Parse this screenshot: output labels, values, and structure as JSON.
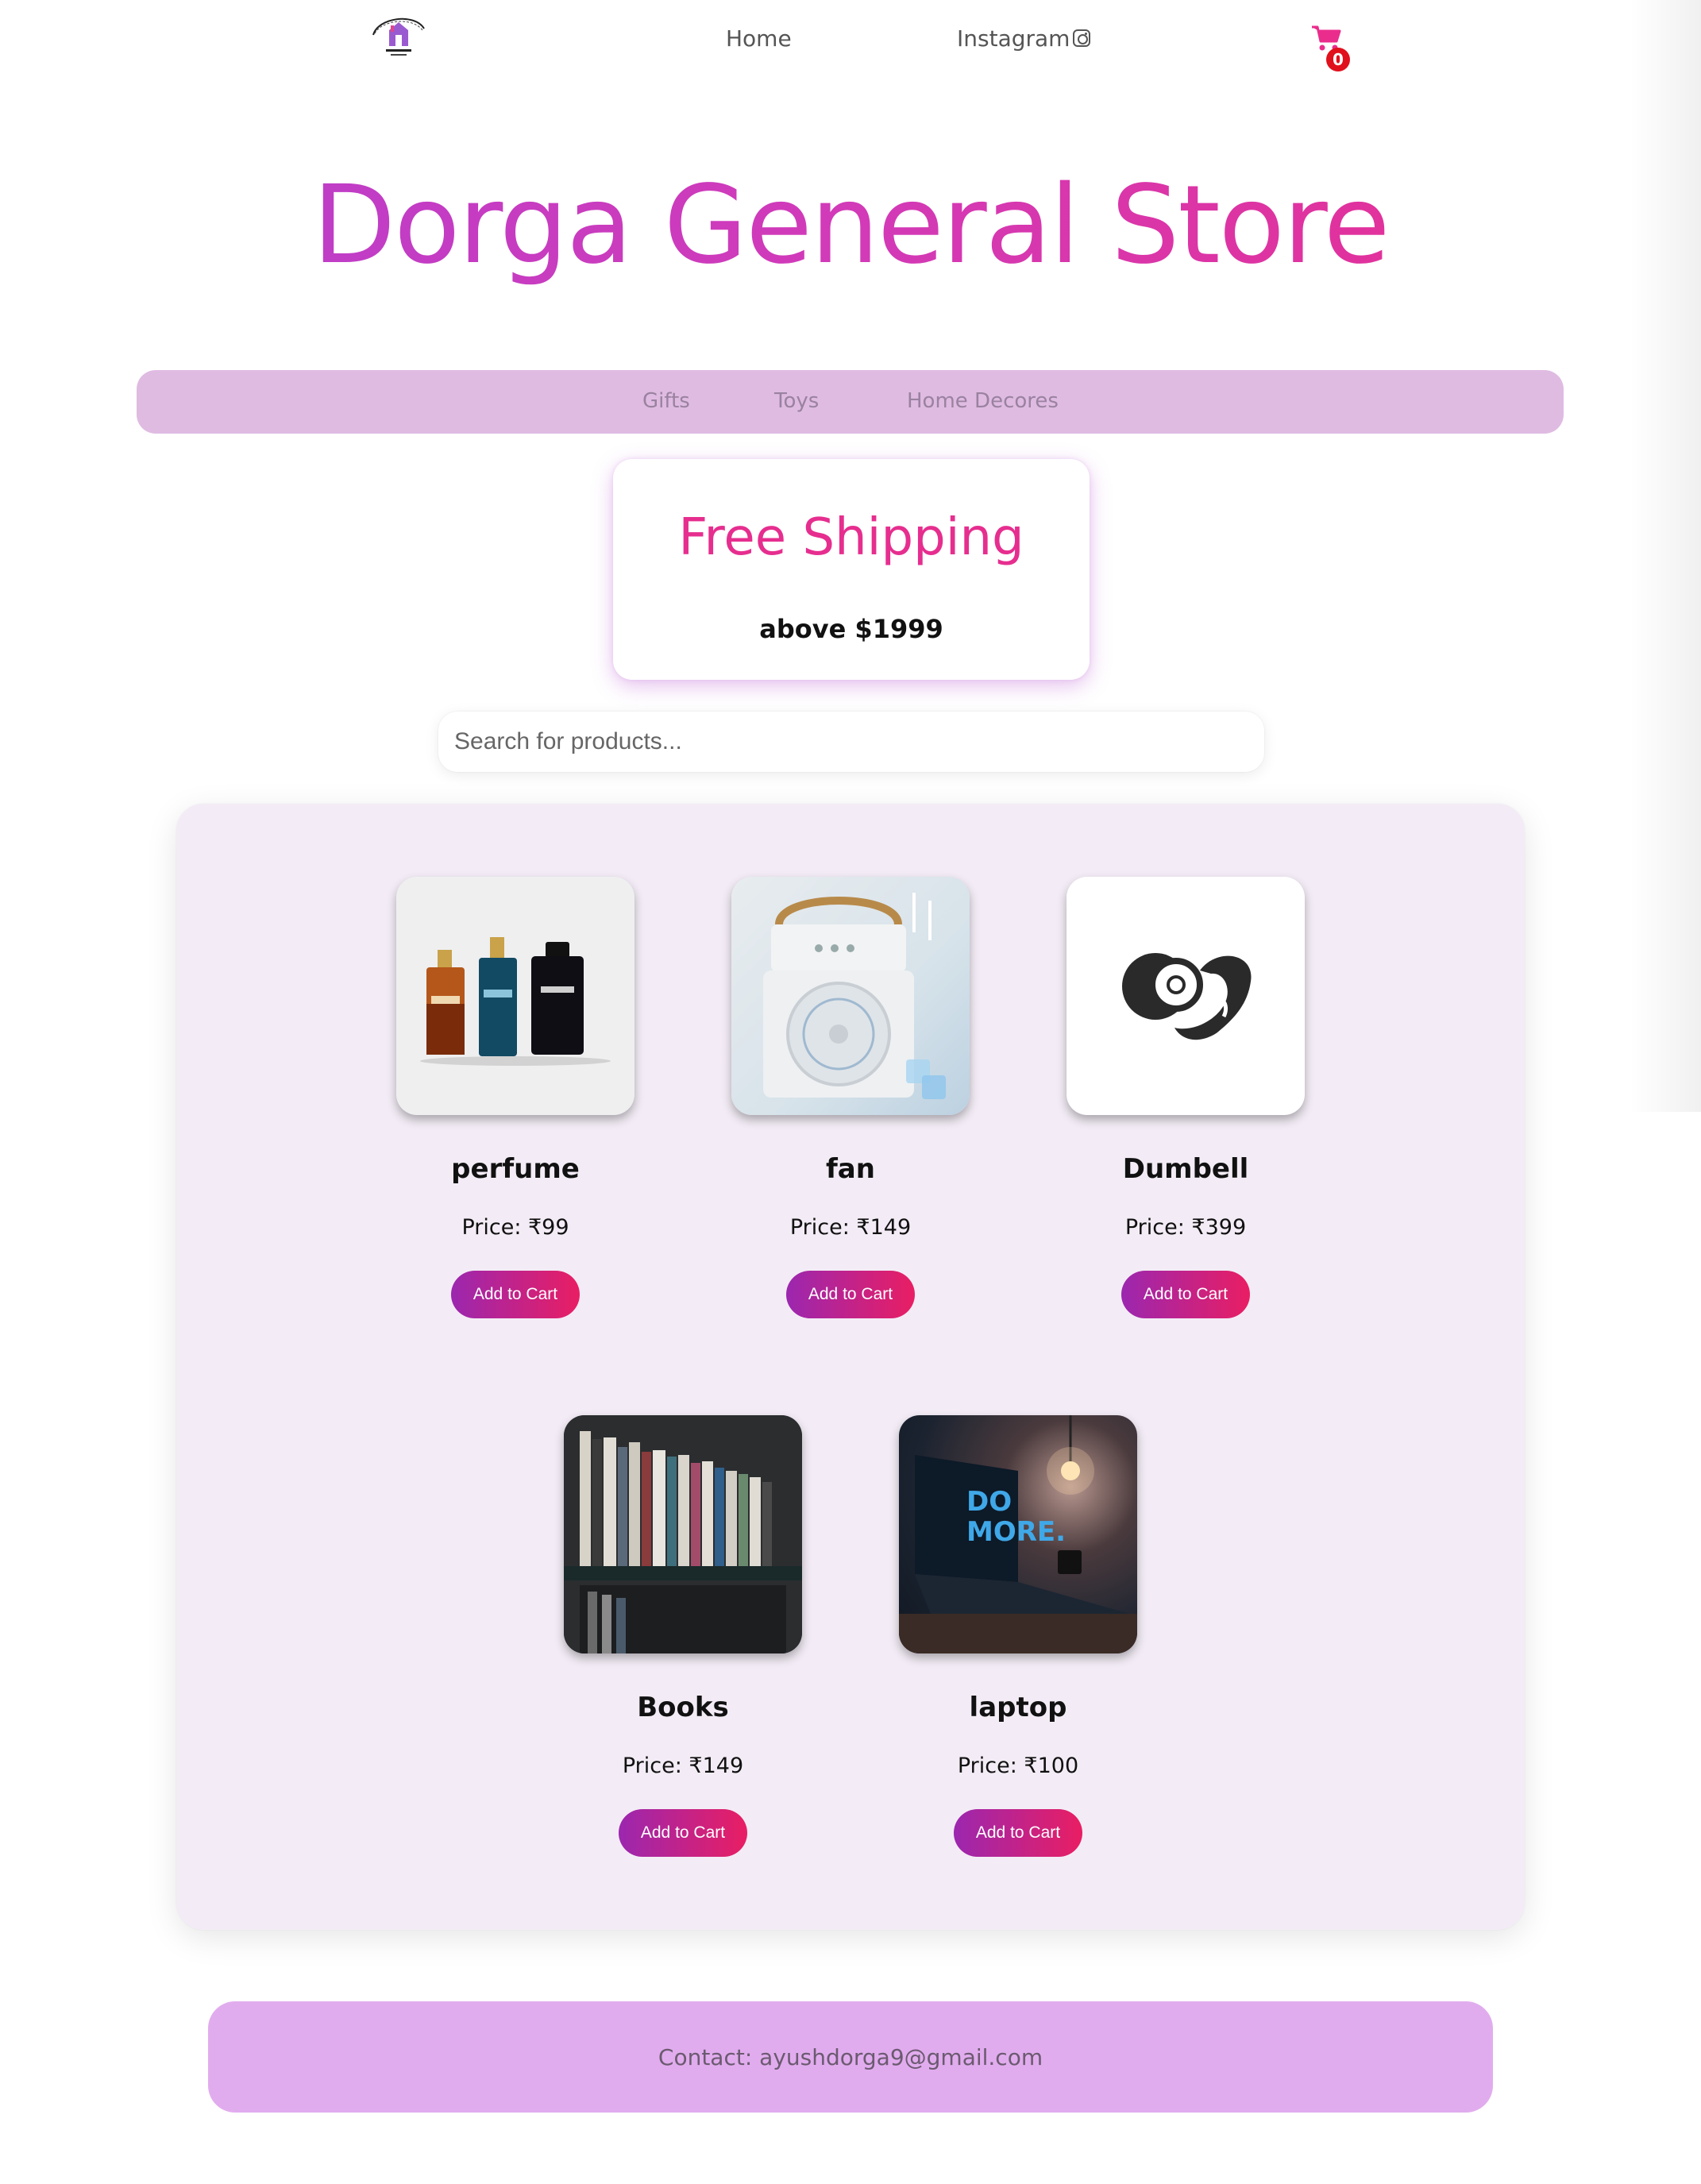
{
  "nav": {
    "home": "Home",
    "instagram": "Instagram",
    "cart_count": "0"
  },
  "site_title": "Dorga General Store",
  "categories": [
    "Gifts",
    "Toys",
    "Home Decores"
  ],
  "promo": {
    "title": "Free Shipping",
    "subtitle": "above $1999"
  },
  "search": {
    "placeholder": "Search for products..."
  },
  "products": [
    {
      "name": "perfume",
      "price": "Price: ₹99",
      "button": "Add to Cart",
      "image": "perfume-bottles"
    },
    {
      "name": "fan",
      "price": "Price: ₹149",
      "button": "Add to Cart",
      "image": "mini-cooler-fan"
    },
    {
      "name": "Dumbell",
      "price": "Price: ₹399",
      "button": "Add to Cart",
      "image": "dumbbell-logo"
    },
    {
      "name": "Books",
      "price": "Price: ₹149",
      "button": "Add to Cart",
      "image": "bookshelf"
    },
    {
      "name": "laptop",
      "price": "Price: ₹100",
      "button": "Add to Cart",
      "image": "laptop-do-more"
    }
  ],
  "footer": {
    "contact": "Contact: ayushdorga9@gmail.com"
  },
  "colors": {
    "title_gradient_start": "#b53fcf",
    "title_gradient_end": "#ea2d8c",
    "category_bar": "#dfbbe2",
    "panel": "#f3ecf6",
    "button_start": "#9b27af",
    "button_end": "#e91e63",
    "footer": "#e1acee",
    "cart_badge": "#e0101c"
  }
}
